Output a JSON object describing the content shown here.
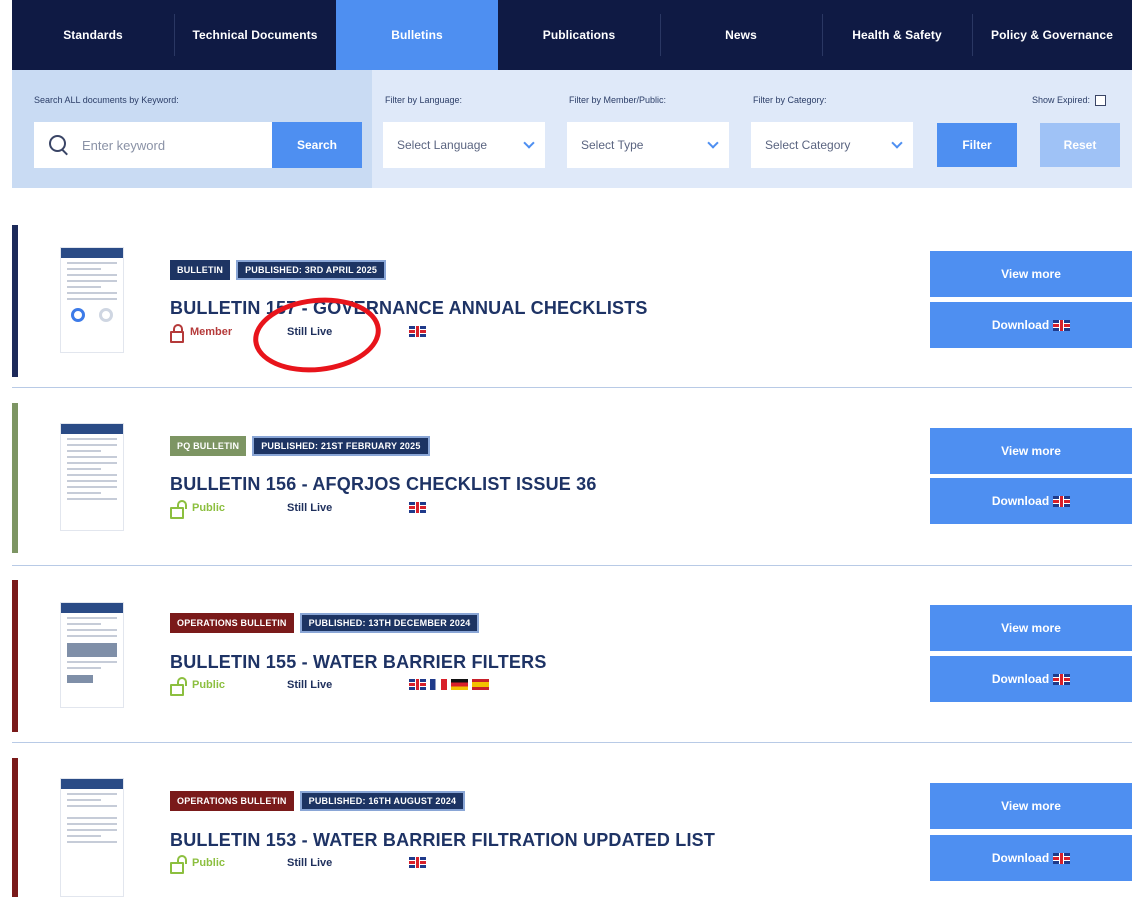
{
  "nav": {
    "tabs": [
      {
        "label": "Standards",
        "active": false
      },
      {
        "label": "Technical Documents",
        "active": false
      },
      {
        "label": "Bulletins",
        "active": true
      },
      {
        "label": "Publications",
        "active": false
      },
      {
        "label": "News",
        "active": false
      },
      {
        "label": "Health & Safety",
        "active": false
      },
      {
        "label": "Policy & Governance",
        "active": false
      }
    ]
  },
  "filters": {
    "search_label": "Search ALL documents by Keyword:",
    "search_placeholder": "Enter keyword",
    "search_button": "Search",
    "language_label": "Filter by Language:",
    "language_value": "Select Language",
    "type_label": "Filter by Member/Public:",
    "type_value": "Select Type",
    "category_label": "Filter by Category:",
    "category_value": "Select Category",
    "filter_button": "Filter",
    "reset_button": "Reset",
    "show_expired_label": "Show Expired:",
    "show_expired_checked": false
  },
  "bulletins": [
    {
      "category": "BULLETIN",
      "published": "PUBLISHED: 3RD APRIL 2025",
      "title": "BULLETIN 157 - GOVERNANCE ANNUAL CHECKLISTS",
      "access": "Member",
      "status": "Still Live",
      "languages": [
        "uk"
      ],
      "view_more": "View more",
      "download": "Download"
    },
    {
      "category": "PQ BULLETIN",
      "published": "PUBLISHED: 21ST FEBRUARY 2025",
      "title": "BULLETIN 156 - AFQRJOS CHECKLIST ISSUE 36",
      "access": "Public",
      "status": "Still Live",
      "languages": [
        "uk"
      ],
      "view_more": "View more",
      "download": "Download"
    },
    {
      "category": "OPERATIONS BULLETIN",
      "published": "PUBLISHED: 13TH DECEMBER 2024",
      "title": "BULLETIN 155 - WATER BARRIER FILTERS",
      "access": "Public",
      "status": "Still Live",
      "languages": [
        "uk",
        "fr",
        "de",
        "es"
      ],
      "view_more": "View more",
      "download": "Download"
    },
    {
      "category": "OPERATIONS BULLETIN",
      "published": "PUBLISHED: 16TH AUGUST 2024",
      "title": "BULLETIN 153 - WATER BARRIER FILTRATION UPDATED LIST",
      "access": "Public",
      "status": "Still Live",
      "languages": [
        "uk"
      ],
      "view_more": "View more",
      "download": "Download"
    }
  ],
  "colors": {
    "nav_bg": "#0f1a44",
    "accent_blue": "#4e8ff1",
    "bulletin_bar": "#1d2a5a",
    "pq_bulletin": "#7d9563",
    "operations_bulletin": "#7a1a1a",
    "member_access": "#b53a3a",
    "public_access": "#8cbf3f",
    "annotation_red": "#e8141b"
  },
  "icons": {
    "search": "search-icon",
    "chevron": "chevron-down-icon",
    "member": "lock-icon",
    "public": "unlock-icon",
    "language_uk": "uk-flag-icon",
    "language_fr": "fr-flag-icon",
    "language_de": "de-flag-icon",
    "language_es": "es-flag-icon"
  }
}
